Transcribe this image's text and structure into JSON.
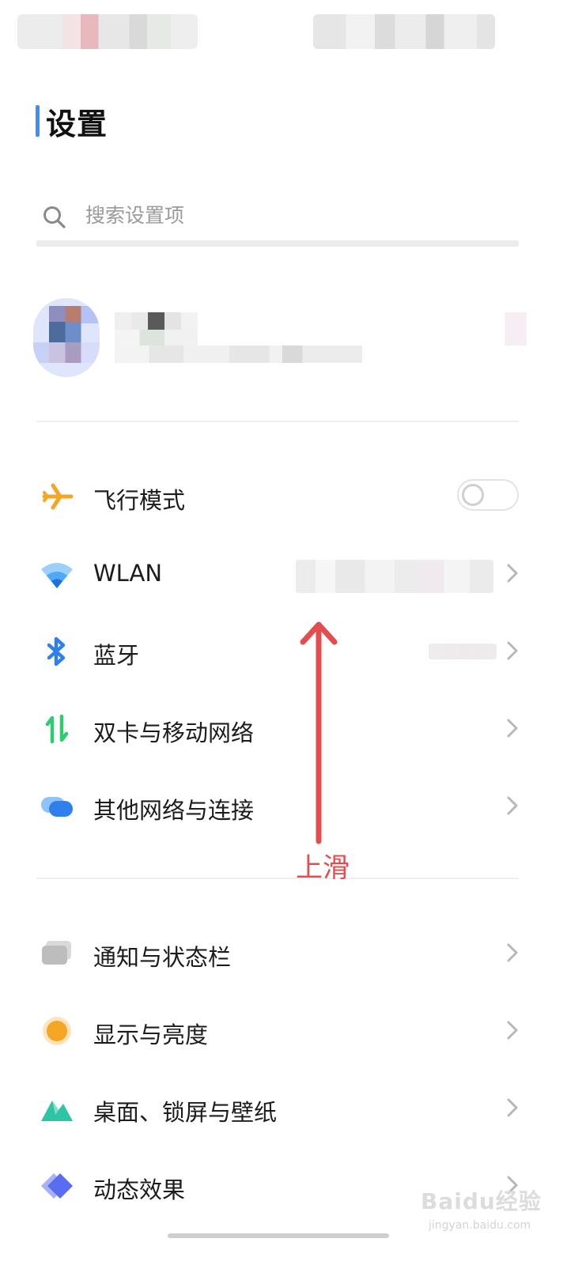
{
  "header": {
    "title": "设置"
  },
  "search": {
    "placeholder": "搜索设置项"
  },
  "connectivity": [
    {
      "id": "airplane",
      "label": "飞行模式",
      "icon": "airplane-icon",
      "has_toggle": true,
      "toggle_on": false
    },
    {
      "id": "wlan",
      "label": "WLAN",
      "icon": "wifi-icon",
      "has_chevron": true
    },
    {
      "id": "bluetooth",
      "label": "蓝牙",
      "icon": "bluetooth-icon",
      "has_chevron": true
    },
    {
      "id": "sim",
      "label": "双卡与移动网络",
      "icon": "mobile-data-icon",
      "has_chevron": true
    },
    {
      "id": "other-networks",
      "label": "其他网络与连接",
      "icon": "connections-icon",
      "has_chevron": true
    }
  ],
  "general": [
    {
      "id": "notifications",
      "label": "通知与状态栏",
      "icon": "notification-icon",
      "has_chevron": true
    },
    {
      "id": "display",
      "label": "显示与亮度",
      "icon": "brightness-icon",
      "has_chevron": true
    },
    {
      "id": "desktop",
      "label": "桌面、锁屏与壁纸",
      "icon": "wallpaper-icon",
      "has_chevron": true
    },
    {
      "id": "animation",
      "label": "动态效果",
      "icon": "animation-icon",
      "has_chevron": true
    }
  ],
  "annotation": {
    "text": "上滑",
    "color": "#e44d4d"
  },
  "watermark": {
    "text": "Baidu经验",
    "url": "jingyan.baidu.com"
  },
  "colors": {
    "accent": "#3d8ff5",
    "airplane": "#f5a623",
    "wifi": "#2f80ed",
    "bluetooth": "#2f80ed",
    "sim": "#2ecc71",
    "display": "#f5a623",
    "wallpaper": "#2ec4a6",
    "animation": "#5a6cf0"
  }
}
